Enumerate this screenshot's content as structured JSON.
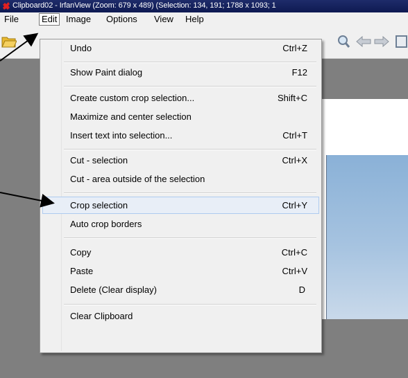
{
  "window": {
    "title": "Clipboard02 - IrfanView (Zoom: 679 x 489) (Selection: 134, 191; 1788 x 1093; 1"
  },
  "menubar": {
    "items": [
      {
        "label": "File"
      },
      {
        "label": "Edit"
      },
      {
        "label": "Image"
      },
      {
        "label": "Options"
      },
      {
        "label": "View"
      },
      {
        "label": "Help"
      }
    ]
  },
  "edit_menu": {
    "items": [
      {
        "label": "Undo",
        "shortcut": "Ctrl+Z"
      },
      {
        "label": "Show Paint dialog",
        "shortcut": "F12"
      },
      {
        "label": "Create custom crop selection...",
        "shortcut": "Shift+C"
      },
      {
        "label": "Maximize and center selection",
        "shortcut": ""
      },
      {
        "label": "Insert text into selection...",
        "shortcut": "Ctrl+T"
      },
      {
        "label": "Cut - selection",
        "shortcut": "Ctrl+X"
      },
      {
        "label": "Cut - area outside of the selection",
        "shortcut": ""
      },
      {
        "label": "Crop selection",
        "shortcut": "Ctrl+Y"
      },
      {
        "label": "Auto crop borders",
        "shortcut": ""
      },
      {
        "label": "Copy",
        "shortcut": "Ctrl+C"
      },
      {
        "label": "Paste",
        "shortcut": "Ctrl+V"
      },
      {
        "label": "Delete (Clear display)",
        "shortcut": "D"
      },
      {
        "label": "Clear Clipboard",
        "shortcut": ""
      }
    ],
    "highlighted": "Crop selection"
  },
  "toolbar": {
    "icons": [
      "folder-open-icon",
      "zoom-icon",
      "arrow-left-icon",
      "arrow-right-icon",
      "page-icon"
    ]
  },
  "colors": {
    "titlebar": "#0e1a52",
    "menu_bg": "#f0f0f0",
    "canvas_bg": "#7f7f7f",
    "highlight": "#e8eef7"
  }
}
